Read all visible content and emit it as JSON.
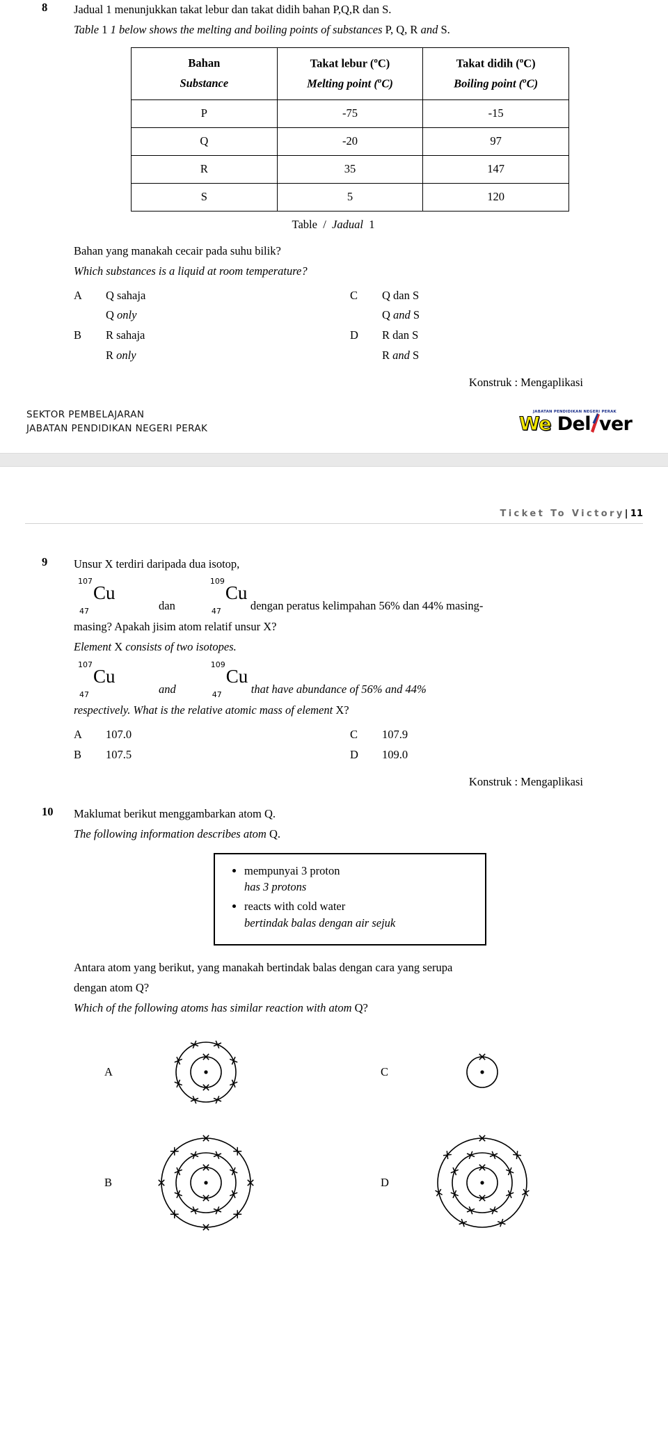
{
  "page1": {
    "q8": {
      "number": "8",
      "stem_bm": "Jadual 1 menunjukkan takat lebur dan takat didih bahan P,Q,R dan S.",
      "stem_en_a": "Table",
      "stem_en_b": "1 below shows the melting and boiling points of substances",
      "stem_en_c": "P, Q, R",
      "stem_en_d": "and",
      "stem_en_e": "S.",
      "table": {
        "headers": [
          {
            "bm": "Bahan",
            "en": "Substance",
            "unit": ""
          },
          {
            "bm": "Takat lebur (°C)",
            "en": "Melting point (°C)",
            "unit": "°C"
          },
          {
            "bm": "Takat didih  (°C)",
            "en": "Boiling point (°C)",
            "unit": "°C"
          }
        ],
        "header_bm": [
          "Bahan",
          "Takat lebur (",
          "Takat didih  ("
        ],
        "rows": [
          {
            "substance": "P",
            "melting": "-75",
            "boiling": "-15"
          },
          {
            "substance": "Q",
            "melting": "-20",
            "boiling": "97"
          },
          {
            "substance": "R",
            "melting": "35",
            "boiling": "147"
          },
          {
            "substance": "S",
            "melting": "5",
            "boiling": "120"
          }
        ],
        "caption_en": "Table",
        "caption_sep": "/",
        "caption_bm": "Jadual",
        "caption_num": "1"
      },
      "question_bm": "Bahan yang manakah cecair pada suhu bilik?",
      "question_en": "Which substances is a liquid at room temperature?",
      "options": [
        {
          "letter": "A",
          "bm": "Q sahaja",
          "en_a": "Q",
          "en_b": "only",
          "en_c": ""
        },
        {
          "letter": "B",
          "bm": "R sahaja",
          "en_a": "R",
          "en_b": "only",
          "en_c": ""
        },
        {
          "letter": "C",
          "bm": "Q dan S",
          "en_a": "Q",
          "en_b": "and",
          "en_c": "S"
        },
        {
          "letter": "D",
          "bm": "R dan S",
          "en_a": "R",
          "en_b": "and",
          "en_c": "S"
        }
      ],
      "konstruk": "Konstruk : Mengaplikasi"
    },
    "footer": {
      "line1": "SEKTOR PEMBELAJARAN",
      "line2": "JABATAN PENDIDIKAN NEGERI PERAK",
      "logo_top": "JABATAN PENDIDIKAN NEGERI PERAK",
      "logo_we": "We",
      "logo_del": "Del",
      "logo_ver": "ver"
    }
  },
  "page2": {
    "running_header": {
      "title": "Ticket To Victory",
      "bar": "|",
      "page_number": "11"
    },
    "q9": {
      "number": "9",
      "stem_bm": "Unsur X terdiri daripada dua isotop,",
      "iso1": {
        "mass": "107",
        "atomic": "47",
        "symbol": "Cu"
      },
      "iso2": {
        "mass": "109",
        "atomic": "47",
        "symbol": "Cu"
      },
      "join_bm": "dan",
      "tail_bm": "dengan peratus kelimpahan 56% dan 44%  masing-",
      "line2_bm": "masing? Apakah jisim atom relatif unsur X?",
      "stem_en_a": "Element",
      "stem_en_b": "X",
      "stem_en_c": "consists of two isotopes.",
      "join_en": "and",
      "tail_en": "that have abundance of 56% and 44%",
      "line2_en_a": "respectively. What is the relative atomic mass of element",
      "line2_en_b": "X?",
      "options": [
        {
          "letter": "A",
          "value": "107.0"
        },
        {
          "letter": "B",
          "value": "107.5"
        },
        {
          "letter": "C",
          "value": "107.9"
        },
        {
          "letter": "D",
          "value": "109.0"
        }
      ],
      "konstruk": "Konstruk : Mengaplikasi"
    },
    "q10": {
      "number": "10",
      "stem_bm_a": "Maklumat berikut menggambarkan atom Q.",
      "stem_en_a": "The following information describes atom",
      "stem_en_b": "Q.",
      "infobox": [
        {
          "bm": "mempunyai 3 proton",
          "en": "has 3 protons"
        },
        {
          "bm": "reacts with cold water",
          "en": "bertindak balas dengan air sejuk"
        }
      ],
      "question_bm_line1": "Antara atom yang berikut, yang manakah bertindak balas dengan cara yang serupa",
      "question_bm_line2": "dengan atom Q?",
      "question_en_a": "Which of the following atoms has similar reaction with atom",
      "question_en_b": "Q?",
      "options": [
        {
          "letter": "A",
          "shells": [
            2,
            8
          ],
          "nucleus": "dot"
        },
        {
          "letter": "B",
          "shells": [
            2,
            8,
            8
          ],
          "nucleus": "dot"
        },
        {
          "letter": "C",
          "shells": [
            1
          ],
          "nucleus": "dot"
        },
        {
          "letter": "D",
          "shells": [
            2,
            8,
            7
          ],
          "nucleus": "dot"
        }
      ]
    }
  },
  "colors": {
    "logo_yellow": "#f2e600",
    "logo_blue": "#1b2f8a",
    "logo_red": "#d8262c",
    "header_gray": "#6b6b6b",
    "page_bg": "#ffffff"
  }
}
